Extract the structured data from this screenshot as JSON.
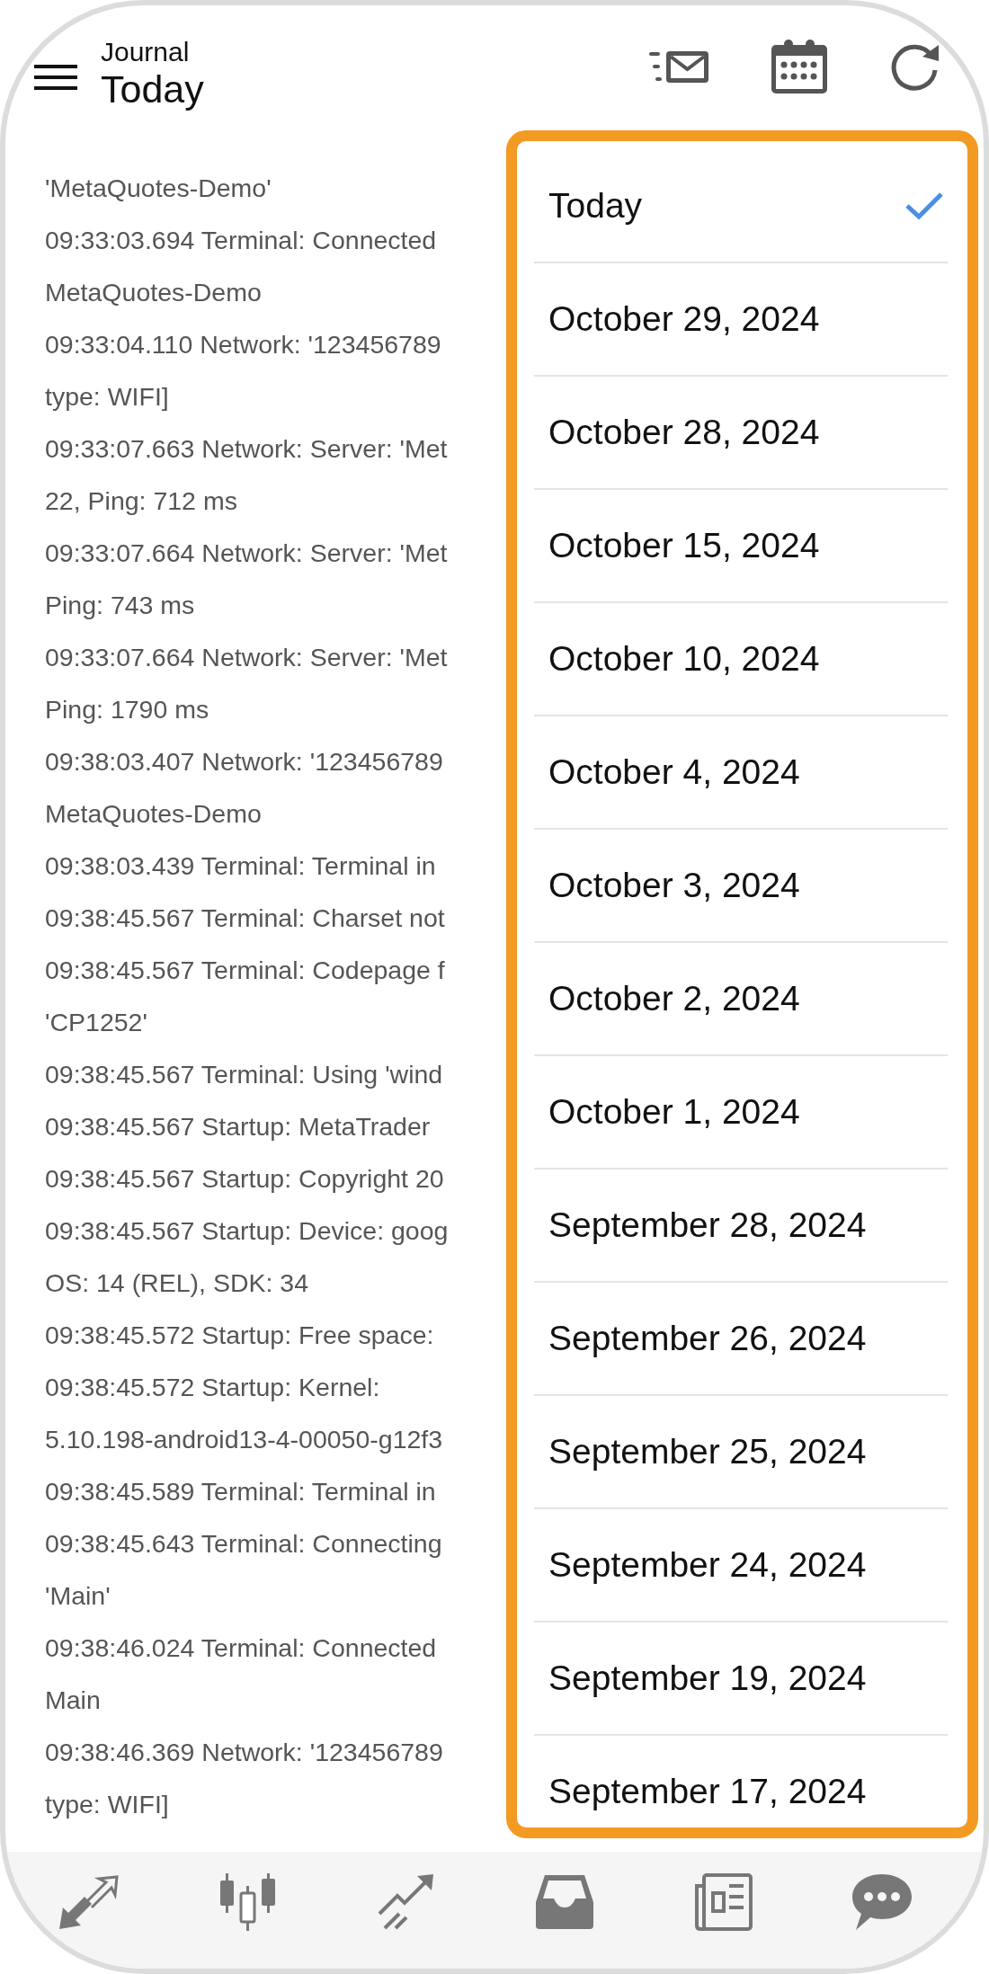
{
  "header": {
    "subtitle": "Journal",
    "title": "Today"
  },
  "log_lines": [
    "'MetaQuotes-Demo'",
    "09:33:03.694 Terminal: Connected",
    "MetaQuotes-Demo",
    "09:33:04.110 Network: '123456789",
    "type: WIFI]",
    "09:33:07.663 Network: Server: 'Met",
    "22, Ping: 712 ms",
    "09:33:07.664 Network: Server: 'Met",
    "Ping: 743 ms",
    "09:33:07.664 Network: Server: 'Met",
    "Ping: 1790 ms",
    "09:38:03.407 Network: '123456789",
    "MetaQuotes-Demo",
    "09:38:03.439 Terminal: Terminal in",
    "09:38:45.567 Terminal: Charset not",
    "09:38:45.567 Terminal: Codepage f",
    "'CP1252'",
    "09:38:45.567 Terminal: Using 'wind",
    "09:38:45.567 Startup: MetaTrader",
    "09:38:45.567 Startup: Copyright 20",
    "09:38:45.567 Startup: Device: goog",
    "OS: 14 (REL), SDK: 34",
    "09:38:45.572 Startup: Free space:",
    "09:38:45.572 Startup: Kernel:",
    "5.10.198-android13-4-00050-g12f3",
    "09:38:45.589 Terminal: Terminal in",
    "09:38:45.643 Terminal: Connecting",
    "'Main'",
    "09:38:46.024 Terminal: Connected",
    "Main",
    "09:38:46.369 Network: '123456789",
    "type: WIFI]"
  ],
  "date_menu": {
    "items": [
      {
        "label": "Today",
        "selected": true
      },
      {
        "label": "October 29, 2024",
        "selected": false
      },
      {
        "label": "October 28, 2024",
        "selected": false
      },
      {
        "label": "October 15, 2024",
        "selected": false
      },
      {
        "label": "October 10, 2024",
        "selected": false
      },
      {
        "label": "October 4, 2024",
        "selected": false
      },
      {
        "label": "October 3, 2024",
        "selected": false
      },
      {
        "label": "October 2, 2024",
        "selected": false
      },
      {
        "label": "October 1, 2024",
        "selected": false
      },
      {
        "label": "September 28, 2024",
        "selected": false
      },
      {
        "label": "September 26, 2024",
        "selected": false
      },
      {
        "label": "September 25, 2024",
        "selected": false
      },
      {
        "label": "September 24, 2024",
        "selected": false
      },
      {
        "label": "September 19, 2024",
        "selected": false
      },
      {
        "label": "September 17, 2024",
        "selected": false
      }
    ]
  }
}
